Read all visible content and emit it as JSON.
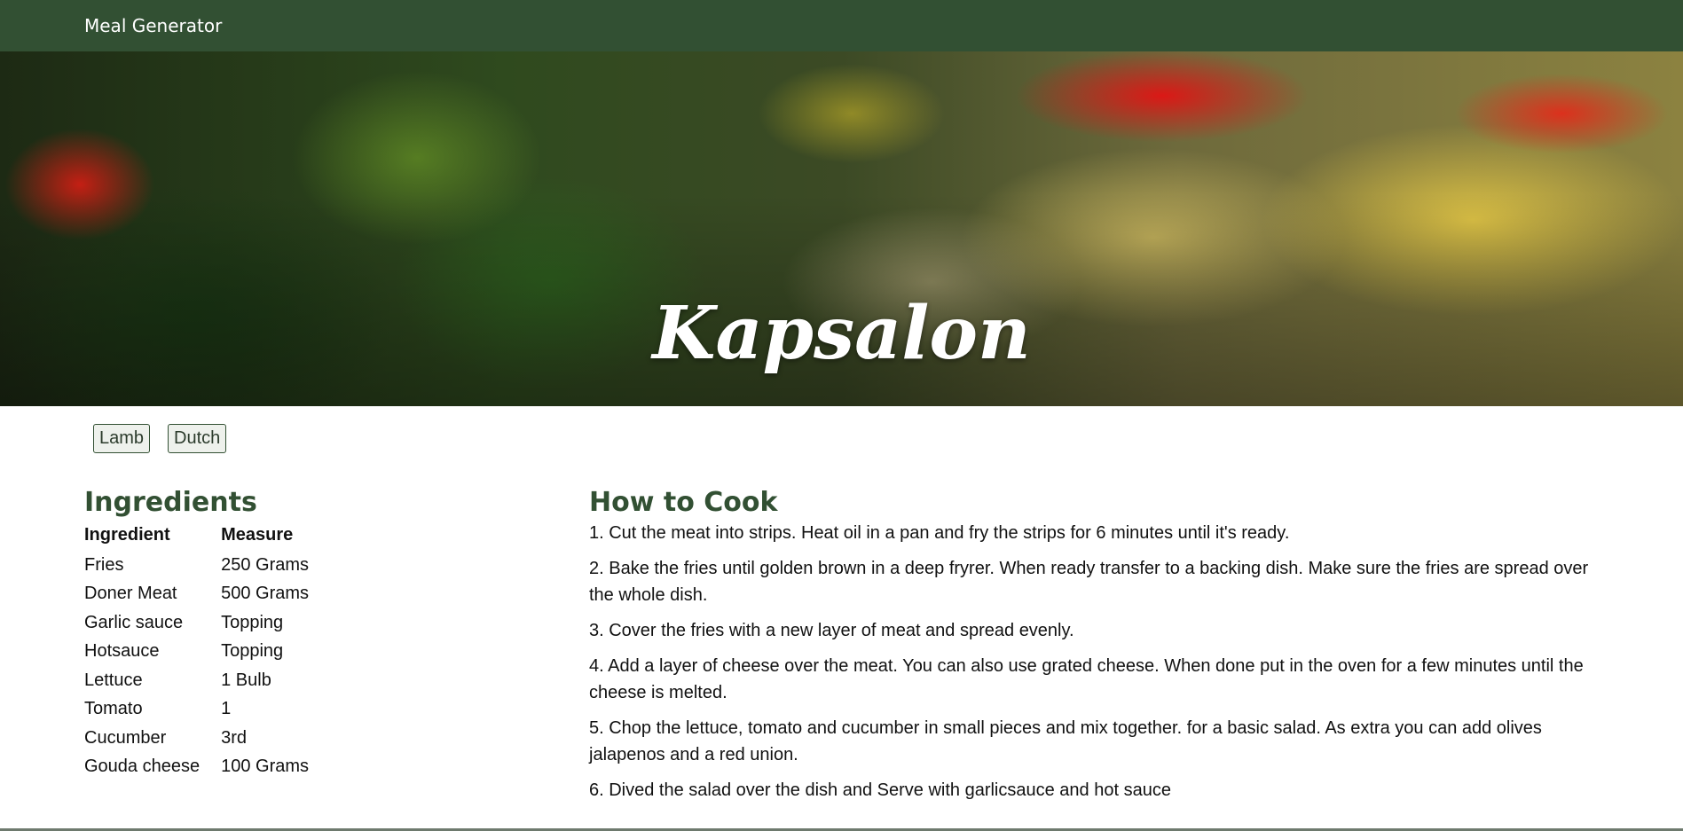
{
  "nav": {
    "brand": "Meal Generator"
  },
  "meal": {
    "name": "Kapsalon",
    "tags": [
      "Lamb",
      "Dutch"
    ]
  },
  "ingredients": {
    "title": "Ingredients",
    "headers": {
      "ingredient": "Ingredient",
      "measure": "Measure"
    },
    "rows": [
      {
        "ingredient": "Fries",
        "measure": "250 Grams"
      },
      {
        "ingredient": "Doner Meat",
        "measure": "500 Grams"
      },
      {
        "ingredient": "Garlic sauce",
        "measure": "Topping"
      },
      {
        "ingredient": "Hotsauce",
        "measure": "Topping"
      },
      {
        "ingredient": "Lettuce",
        "measure": "1 Bulb"
      },
      {
        "ingredient": "Tomato",
        "measure": "1"
      },
      {
        "ingredient": "Cucumber",
        "measure": "3rd"
      },
      {
        "ingredient": "Gouda cheese",
        "measure": "100 Grams"
      }
    ]
  },
  "instructions": {
    "title": "How to Cook",
    "steps": [
      "1. Cut the meat into strips. Heat oil in a pan and fry the strips for 6 minutes until it's ready.",
      "2. Bake the fries until golden brown in a deep fryrer. When ready transfer to a backing dish. Make sure the fries are spread over the whole dish.",
      "3. Cover the fries with a new layer of meat and spread evenly.",
      "4. Add a layer of cheese over the meat. You can also use grated cheese. When done put in the oven for a few minutes until the cheese is melted.",
      "5. Chop the lettuce, tomato and cucumber in small pieces and mix together. for a basic salad. As extra you can add olives jalapenos and a red union.",
      "6. Dived the salad over the dish and Serve with garlicsauce and hot sauce"
    ]
  },
  "colors": {
    "nav_bg": "#325033",
    "heading": "#325033"
  }
}
